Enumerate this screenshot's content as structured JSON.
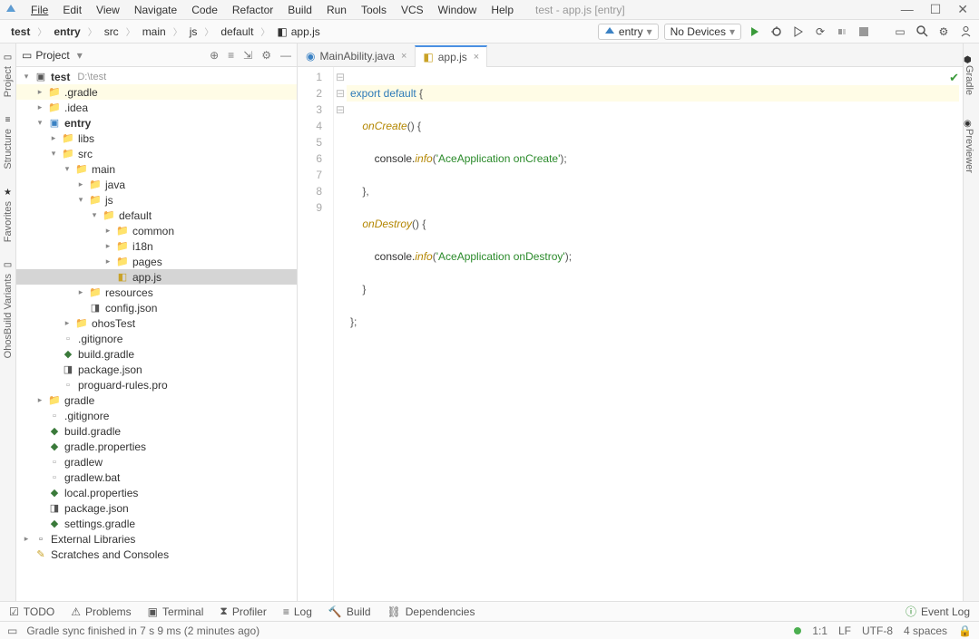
{
  "window": {
    "title": "test - app.js [entry]"
  },
  "menu": [
    "File",
    "Edit",
    "View",
    "Navigate",
    "Code",
    "Refactor",
    "Build",
    "Run",
    "Tools",
    "VCS",
    "Window",
    "Help"
  ],
  "breadcrumbs": [
    "test",
    "entry",
    "src",
    "main",
    "js",
    "default",
    "app.js"
  ],
  "run": {
    "config": "entry",
    "device": "No Devices"
  },
  "projpanel": {
    "title": "Project"
  },
  "tree": [
    {
      "d": 0,
      "a": "v",
      "i": "proj",
      "l": "test",
      "sub": "D:\\test",
      "bold": true
    },
    {
      "d": 1,
      "a": ">",
      "i": "dir",
      "l": ".gradle",
      "hl": true
    },
    {
      "d": 1,
      "a": ">",
      "i": "dir",
      "l": ".idea"
    },
    {
      "d": 1,
      "a": "v",
      "i": "mod",
      "l": "entry",
      "bold": true
    },
    {
      "d": 2,
      "a": ">",
      "i": "dir",
      "l": "libs"
    },
    {
      "d": 2,
      "a": "v",
      "i": "dir",
      "l": "src"
    },
    {
      "d": 3,
      "a": "v",
      "i": "dir",
      "l": "main"
    },
    {
      "d": 4,
      "a": ">",
      "i": "dir",
      "l": "java"
    },
    {
      "d": 4,
      "a": "v",
      "i": "dir",
      "l": "js"
    },
    {
      "d": 5,
      "a": "v",
      "i": "dir",
      "l": "default"
    },
    {
      "d": 6,
      "a": ">",
      "i": "dir",
      "l": "common"
    },
    {
      "d": 6,
      "a": ">",
      "i": "dir",
      "l": "i18n"
    },
    {
      "d": 6,
      "a": ">",
      "i": "dir",
      "l": "pages"
    },
    {
      "d": 6,
      "a": "",
      "i": "js",
      "l": "app.js",
      "sel": true
    },
    {
      "d": 4,
      "a": ">",
      "i": "dir",
      "l": "resources"
    },
    {
      "d": 4,
      "a": "",
      "i": "json",
      "l": "config.json"
    },
    {
      "d": 3,
      "a": ">",
      "i": "dir",
      "l": "ohosTest"
    },
    {
      "d": 2,
      "a": "",
      "i": "file",
      "l": ".gitignore"
    },
    {
      "d": 2,
      "a": "",
      "i": "gradle",
      "l": "build.gradle"
    },
    {
      "d": 2,
      "a": "",
      "i": "json",
      "l": "package.json"
    },
    {
      "d": 2,
      "a": "",
      "i": "file",
      "l": "proguard-rules.pro"
    },
    {
      "d": 1,
      "a": ">",
      "i": "dir",
      "l": "gradle"
    },
    {
      "d": 1,
      "a": "",
      "i": "file",
      "l": ".gitignore"
    },
    {
      "d": 1,
      "a": "",
      "i": "gradle",
      "l": "build.gradle"
    },
    {
      "d": 1,
      "a": "",
      "i": "gradle",
      "l": "gradle.properties"
    },
    {
      "d": 1,
      "a": "",
      "i": "file",
      "l": "gradlew"
    },
    {
      "d": 1,
      "a": "",
      "i": "file",
      "l": "gradlew.bat"
    },
    {
      "d": 1,
      "a": "",
      "i": "gradle",
      "l": "local.properties"
    },
    {
      "d": 1,
      "a": "",
      "i": "json",
      "l": "package.json"
    },
    {
      "d": 1,
      "a": "",
      "i": "gradle",
      "l": "settings.gradle"
    },
    {
      "d": 0,
      "a": ">",
      "i": "lib",
      "l": "External Libraries"
    },
    {
      "d": 0,
      "a": "",
      "i": "scratch",
      "l": "Scratches and Consoles"
    }
  ],
  "tabs": [
    {
      "icon": "java",
      "label": "MainAbility.java",
      "active": false
    },
    {
      "icon": "js",
      "label": "app.js",
      "active": true
    }
  ],
  "code": {
    "linenums": [
      "1",
      "2",
      "3",
      "4",
      "5",
      "6",
      "7",
      "8",
      "9"
    ],
    "fold": [
      "⊟",
      "⊟",
      "",
      "",
      "",
      "",
      "",
      "⊟",
      ""
    ],
    "line1_kw": "export default",
    "line1_p": " {",
    "line2_fn": "onCreate",
    "line2_p": "() {",
    "line3_a": "console.",
    "line3_fn": "info",
    "line3_b": "(",
    "line3_s": "'AceApplication onCreate'",
    "line3_c": ");",
    "line4": "},",
    "line5_fn": "onDestroy",
    "line5_p": "() {",
    "line6_a": "console.",
    "line6_fn": "info",
    "line6_b": "(",
    "line6_s": "'AceApplication onDestroy'",
    "line6_c": ");",
    "line7": "}",
    "line8": "};"
  },
  "leftrail": [
    "Project",
    "Structure",
    "Favorites",
    "OhosBuild Variants"
  ],
  "rightrail": [
    "Gradle",
    "Previewer"
  ],
  "bottombar": {
    "todo": "TODO",
    "problems": "Problems",
    "terminal": "Terminal",
    "profiler": "Profiler",
    "log": "Log",
    "build": "Build",
    "deps": "Dependencies",
    "eventlog": "Event Log"
  },
  "status": {
    "msg": "Gradle sync finished in 7 s 9 ms (2 minutes ago)",
    "pos": "1:1",
    "le": "LF",
    "enc": "UTF-8",
    "indent": "4 spaces"
  }
}
